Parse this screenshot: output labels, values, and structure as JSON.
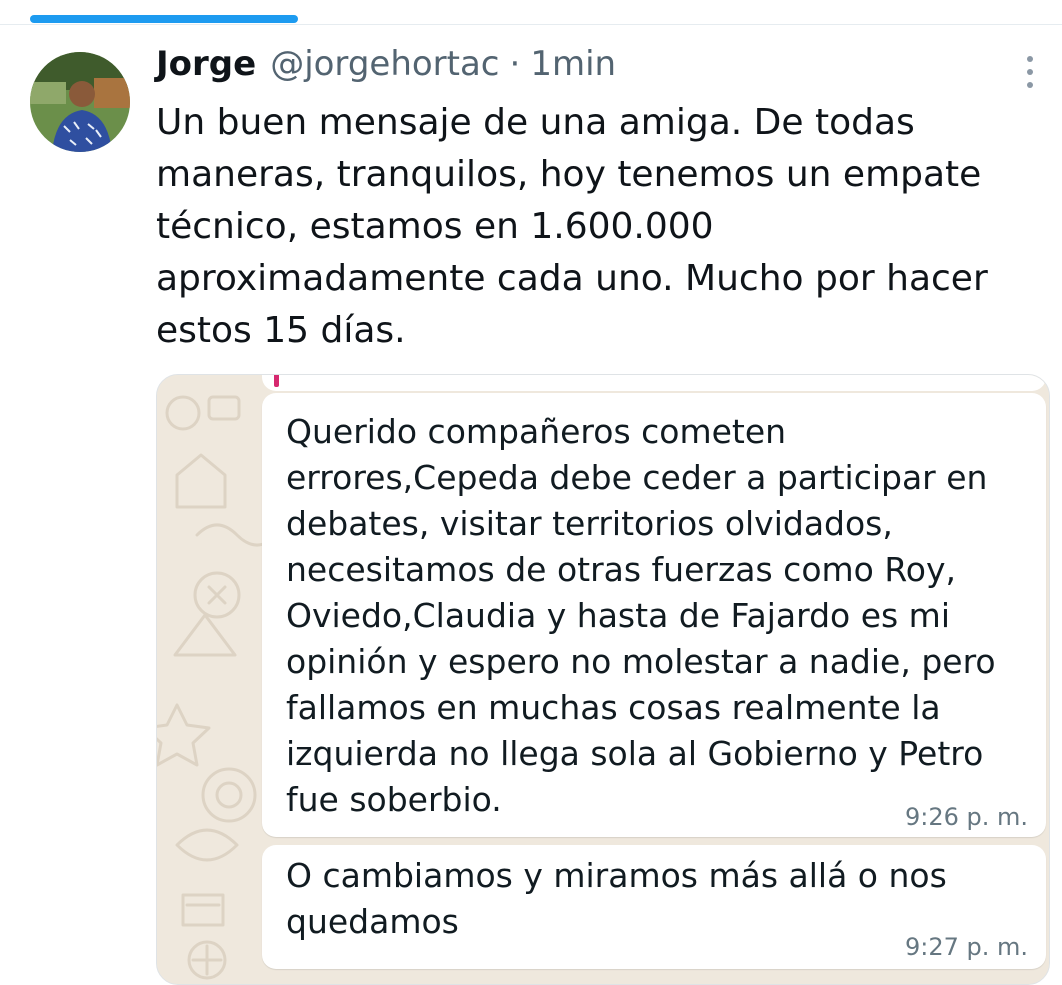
{
  "tweet": {
    "author_name": "Jorge",
    "handle": "@jorgehortac",
    "separator": "·",
    "time": "1min",
    "text": "Un buen mensaje de una amiga. De todas maneras, tranquilos, hoy tenemos un empate técnico, estamos en 1.600.000 aproximadamente cada uno. Mucho por hacer estos 15 días.",
    "more_icon": "more-vertical-icon",
    "accent_color": "#1d9bf0"
  },
  "chat_screenshot": {
    "messages": [
      {
        "text": "Querido compañeros cometen errores,Cepeda debe ceder a participar en debates, visitar territorios olvidados, necesitamos de otras fuerzas como Roy, Oviedo,Claudia y hasta de Fajardo es mi opinión y espero no molestar a nadie, pero fallamos en muchas cosas realmente la izquierda no llega sola al Gobierno y Petro fue soberbio.",
        "time": "9:26 p. m."
      },
      {
        "text": "O cambiamos y miramos más allá o nos quedamos",
        "time": "9:27 p. m."
      }
    ],
    "wallpaper_color": "#efe8dd",
    "bubble_color": "#ffffff",
    "quote_bar_color": "#d6286f"
  }
}
